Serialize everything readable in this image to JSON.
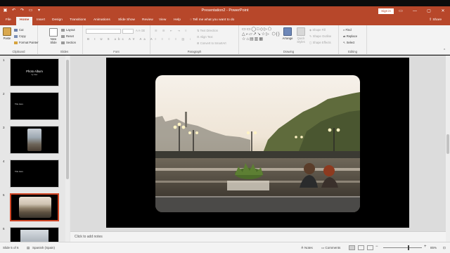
{
  "titlebar": {
    "title": "Presentation2 - PowerPoint",
    "sign_in": "Sign in",
    "qat_icons": [
      "save-icon",
      "undo-icon",
      "redo-icon",
      "present-icon",
      "customize-icon"
    ],
    "minimize": "—",
    "restore": "▢",
    "close": "✕",
    "ribbon_options": "▭"
  },
  "tabs": [
    "File",
    "Home",
    "Insert",
    "Design",
    "Transitions",
    "Animations",
    "Slide Show",
    "Review",
    "View",
    "Help"
  ],
  "active_tab": "Home",
  "tell_me": "Tell me what you want to do",
  "share": "Share",
  "ribbon": {
    "clipboard": {
      "label": "Clipboard",
      "paste": "Paste",
      "cut": "Cut",
      "copy": "Copy",
      "format_painter": "Format Painter"
    },
    "slides": {
      "label": "Slides",
      "new_slide": "New Slide",
      "layout": "Layout",
      "reset": "Reset",
      "section": "Section"
    },
    "font": {
      "label": "Font"
    },
    "paragraph": {
      "label": "Paragraph",
      "text_direction": "Text Direction",
      "align_text": "Align Text",
      "convert": "Convert to SmartArt"
    },
    "drawing": {
      "label": "Drawing",
      "arrange": "Arrange",
      "quick_styles": "Quick Styles",
      "shape_fill": "Shape Fill",
      "shape_outline": "Shape Outline",
      "shape_effects": "Shape Effects"
    },
    "editing": {
      "label": "Editing",
      "find": "Find",
      "replace": "Replace",
      "select": "Select"
    }
  },
  "slides": [
    {
      "number": "1",
      "title": "Photo Album",
      "subtitle": "by User"
    },
    {
      "number": "2",
      "small": "Title Here"
    },
    {
      "number": "3"
    },
    {
      "number": "4",
      "small": "Title Here"
    },
    {
      "number": "5"
    },
    {
      "number": "6"
    }
  ],
  "selected_slide": 5,
  "notes_placeholder": "Click to add notes",
  "status": {
    "slide_of": "Slide 5 of 6",
    "language": "Spanish (Spain)",
    "notes": "Notes",
    "comments": "Comments",
    "zoom": "85%"
  },
  "colors": {
    "accent": "#b7472a",
    "selected_border": "#d24726"
  }
}
